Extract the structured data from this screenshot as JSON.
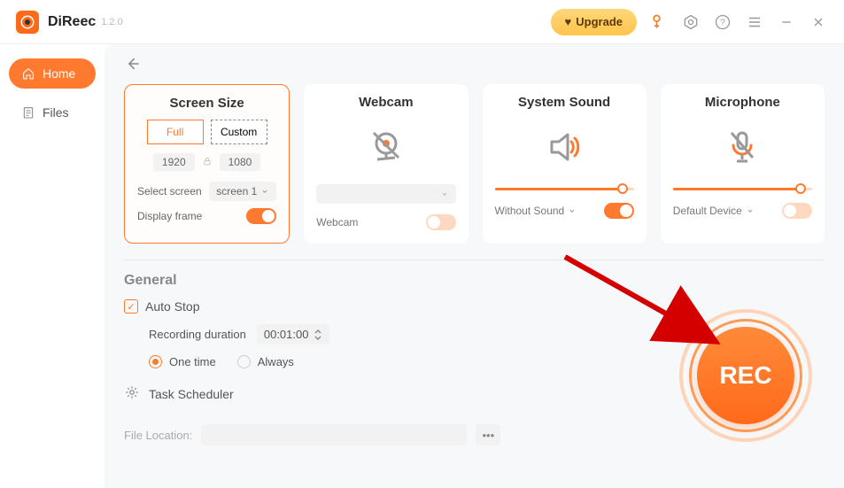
{
  "app": {
    "name": "DiReec",
    "version": "1.2.0"
  },
  "topbar": {
    "upgrade": "Upgrade"
  },
  "sidebar": {
    "items": [
      {
        "label": "Home"
      },
      {
        "label": "Files"
      }
    ]
  },
  "cards": {
    "screen": {
      "title": "Screen Size",
      "full": "Full",
      "custom": "Custom",
      "width": "1920",
      "height": "1080",
      "select_screen_label": "Select screen",
      "select_screen_value": "screen 1",
      "display_frame_label": "Display frame"
    },
    "webcam": {
      "title": "Webcam",
      "label": "Webcam"
    },
    "system_sound": {
      "title": "System Sound",
      "label": "Without Sound"
    },
    "microphone": {
      "title": "Microphone",
      "label": "Default Device"
    }
  },
  "general": {
    "title": "General",
    "auto_stop": "Auto Stop",
    "recording_duration_label": "Recording duration",
    "recording_duration_value": "00:01:00",
    "one_time": "One time",
    "always": "Always",
    "task_scheduler": "Task Scheduler",
    "file_location_label": "File Location:"
  },
  "rec": {
    "label": "REC"
  }
}
